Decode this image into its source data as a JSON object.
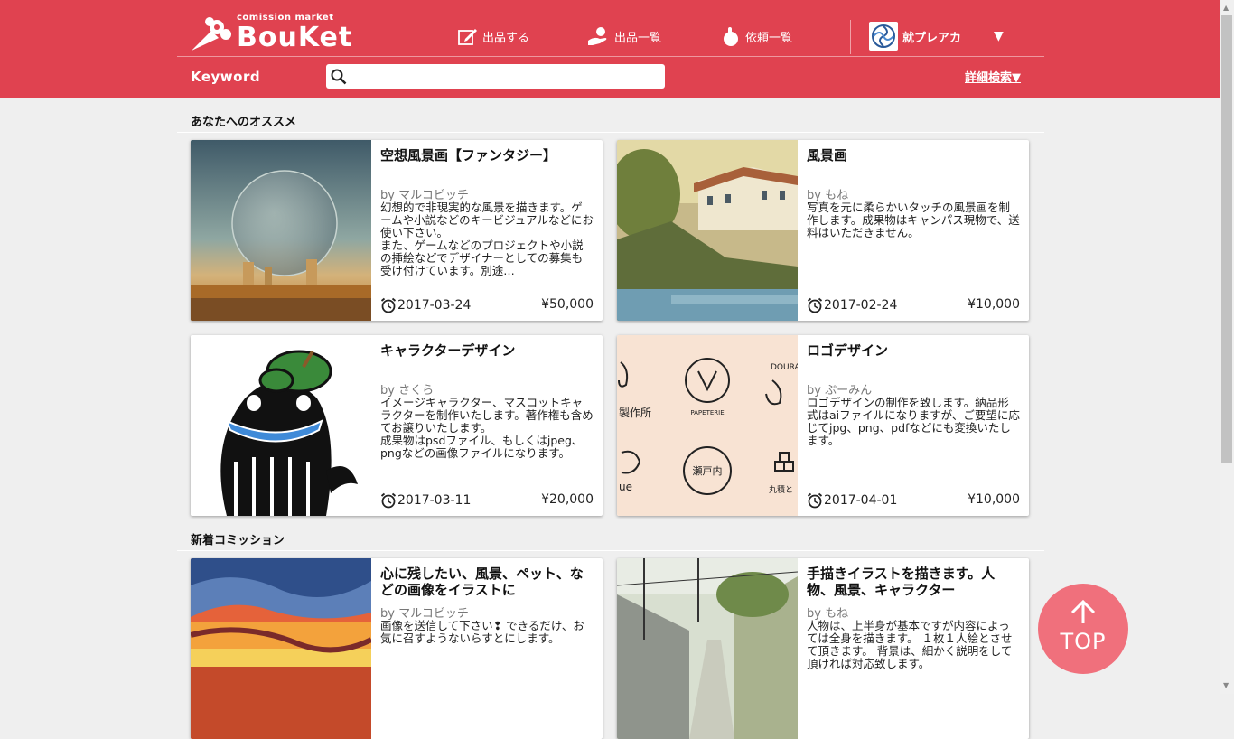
{
  "header": {
    "logo_tag": "comission market",
    "logo_word": "BouKet",
    "nav": [
      {
        "label": "出品する",
        "icon": "edit-icon"
      },
      {
        "label": "出品一覧",
        "icon": "hand-icon"
      },
      {
        "label": "依頼一覧",
        "icon": "request-icon"
      }
    ],
    "user_name": "就プレアカ",
    "user_caret": "▼",
    "keyword_label": "Keyword",
    "search_placeholder": "",
    "advanced_search": "詳細検索▼"
  },
  "sections": [
    {
      "title": "あなたへのオススメ",
      "cards": [
        {
          "title": "空想風景画【ファンタジー】",
          "author_prefix": "by",
          "author": "マルコビッチ",
          "desc": "幻想的で非現実的な風景を描きます。ゲームや小説などのキービジュアルなどにお使い下さい。\nまた、ゲームなどのプロジェクトや小説の挿絵などでデザイナーとしての募集も受け付けています。別途…",
          "date": "2017-03-24",
          "price": "¥50,000"
        },
        {
          "title": "風景画",
          "author_prefix": "by",
          "author": "もね",
          "desc": "写真を元に柔らかいタッチの風景画を制作します。成果物はキャンパス現物で、送料はいただきません。",
          "date": "2017-02-24",
          "price": "¥10,000"
        },
        {
          "title": "キャラクターデザイン",
          "author_prefix": "by",
          "author": "さくら",
          "desc": "イメージキャラクター、マスコットキャラクターを制作いたします。著作権も含めてお譲りいたします。\n成果物はpsdファイル、もしくはjpeg、pngなどの画像ファイルになります。",
          "date": "2017-03-11",
          "price": "¥20,000"
        },
        {
          "title": "ロゴデザイン",
          "author_prefix": "by",
          "author": "ぷーみん",
          "desc": "ロゴデザインの制作を致します。納品形式はaiファイルになりますが、ご要望に応じてjpg、png、pdfなどにも変換いたします。",
          "date": "2017-04-01",
          "price": "¥10,000"
        }
      ]
    },
    {
      "title": "新着コミッション",
      "cards": [
        {
          "title": "心に残したい、風景、ペット、などの画像をイラストに",
          "author_prefix": "by",
          "author": "マルコビッチ",
          "desc": "画像を送信して下さい❢ できるだけ、お気に召すようないらすとにします。"
        },
        {
          "title": "手描きイラストを描きます。人物、風景、キャラクター",
          "author_prefix": "by",
          "author": "もね",
          "desc": "人物は、上半身が基本ですが内容によっては全身を描きます。 １枚１人絵とさせて頂きます。 背景は、細かく説明をして頂ければ対応致します。"
        }
      ]
    }
  ],
  "logo_sample": {
    "circle1": "PAPETERIE",
    "circle2": "瀬戸内",
    "mark": "製作所",
    "corner": "DOURA",
    "bottom": "丸積と",
    "partial": "ue"
  },
  "top_button": "TOP",
  "colors": {
    "header": "#e04250",
    "top_button": "#f0707c",
    "background": "#efefef"
  }
}
